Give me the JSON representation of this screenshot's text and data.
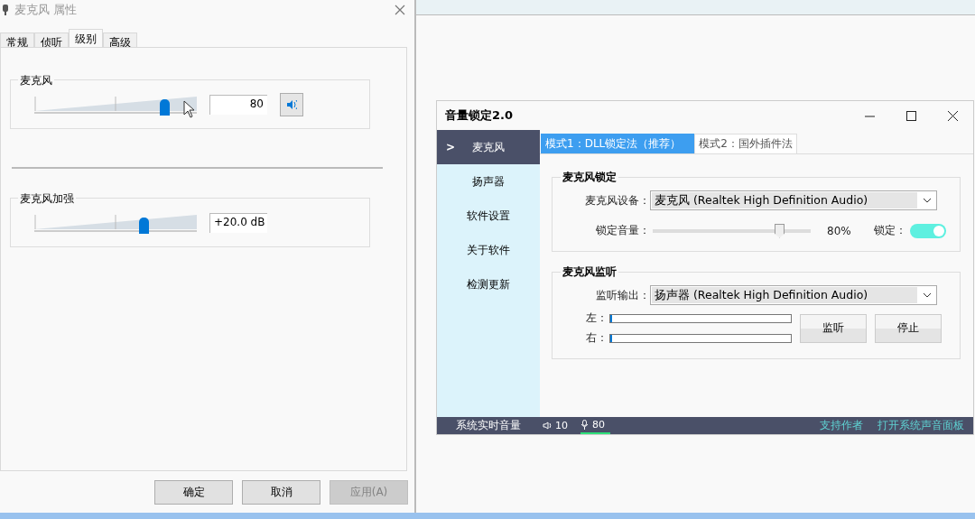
{
  "properties_dialog": {
    "title": "麦克风 属性",
    "tabs": [
      {
        "label": "常规",
        "selected": false
      },
      {
        "label": "侦听",
        "selected": false
      },
      {
        "label": "级别",
        "selected": true
      },
      {
        "label": "高级",
        "selected": false
      }
    ],
    "levels": [
      {
        "kind": "with-mute",
        "label": "麦克风",
        "level": 0.8,
        "value": "80"
      },
      {
        "kind": "plain",
        "label": "麦克风加强",
        "level": 0.67,
        "value": "+20.0 dB"
      }
    ],
    "buttons": [
      {
        "label": "确定",
        "disabled": false
      },
      {
        "label": "取消",
        "disabled": false
      },
      {
        "label": "应用(A)",
        "disabled": true
      }
    ]
  },
  "app_window": {
    "title": "音量锁定2.0",
    "sidebar": {
      "marker": ">",
      "items": [
        {
          "label": "麦克风",
          "selected": true
        },
        {
          "label": "扬声器",
          "selected": false
        },
        {
          "label": "软件设置",
          "selected": false
        },
        {
          "label": "关于软件",
          "selected": false
        },
        {
          "label": "检测更新",
          "selected": false
        }
      ]
    },
    "tabs": [
      {
        "label": "模式1：DLL锁定法（推荐）",
        "selected": true
      },
      {
        "label": "模式2：国外插件法",
        "selected": false
      }
    ],
    "lock_group": {
      "title": "麦克风锁定",
      "device_label": "麦克风设备：",
      "device": "麦克风 (Realtek High Definition Audio)",
      "volume_label": "锁定音量：",
      "level": 0.8,
      "volume": "80%",
      "lock_label": "锁定：",
      "locked": true
    },
    "monitor_group": {
      "title": "麦克风监听",
      "output_label": "监听输出：",
      "output": "扬声器 (Realtek High Definition Audio)",
      "meters": [
        {
          "label": "左：",
          "level": 0.01
        },
        {
          "label": "右：",
          "level": 0.01
        }
      ],
      "buttons": [
        "监听",
        "停止"
      ]
    },
    "status_bar": {
      "label": "系统实时音量",
      "speaker_volume": "10",
      "mic_volume": "80",
      "links": [
        "支持作者",
        "打开系统声音面板"
      ]
    }
  }
}
